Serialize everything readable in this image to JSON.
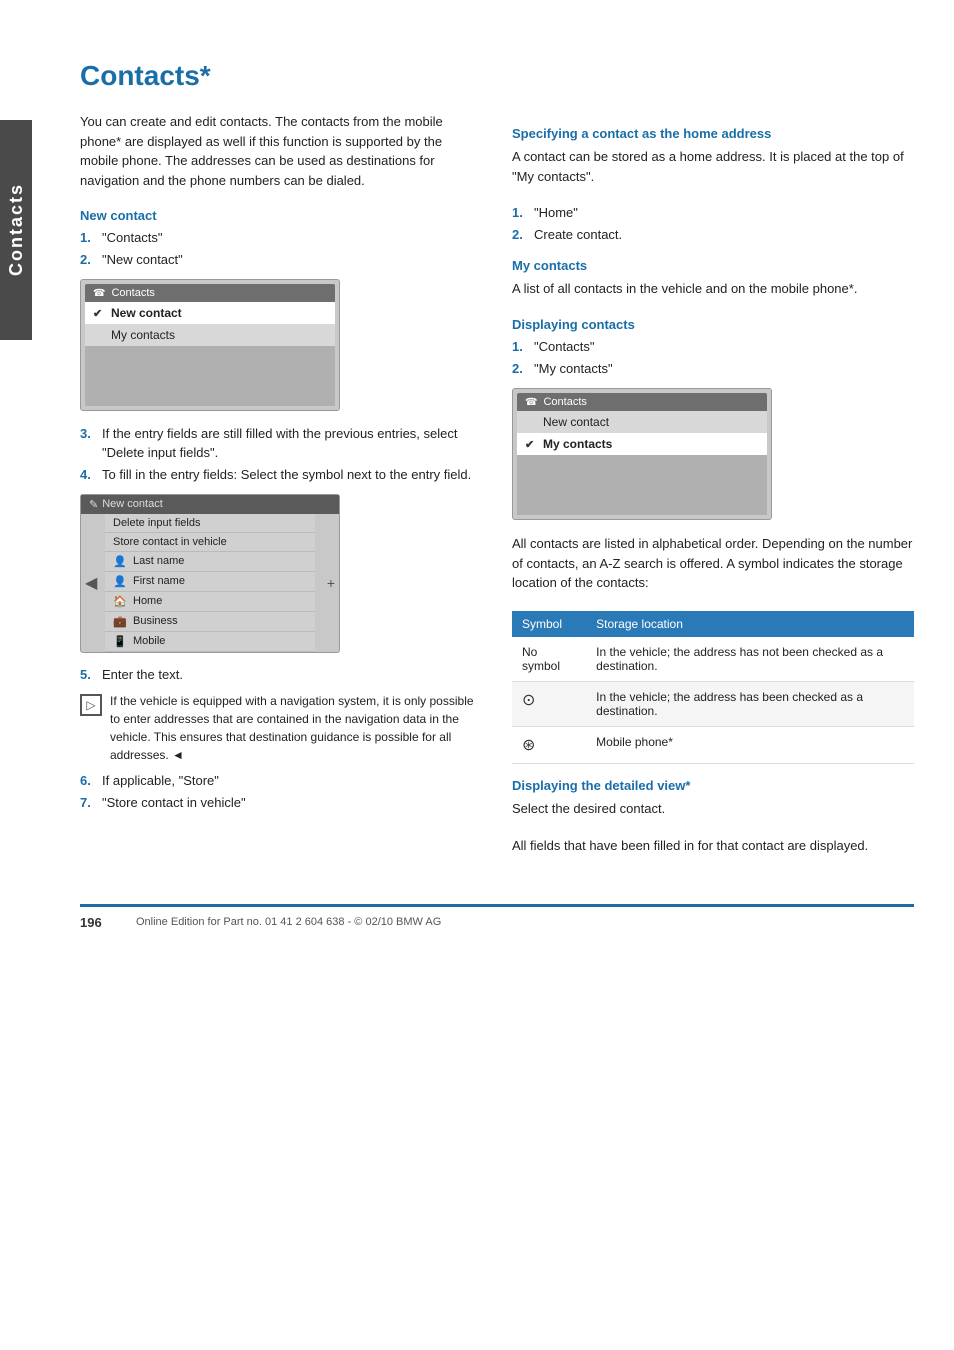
{
  "side_tab": {
    "label": "Contacts"
  },
  "page_title": "Contacts*",
  "intro": "You can create and edit contacts. The contacts from the mobile phone* are displayed as well if this function is supported by the mobile phone. The addresses can be used as destinations for navigation and the phone numbers can be dialed.",
  "left_column": {
    "new_contact": {
      "heading": "New contact",
      "steps": [
        {
          "num": "1.",
          "text": "\"Contacts\""
        },
        {
          "num": "2.",
          "text": "\"New contact\""
        }
      ],
      "ui1": {
        "title": "Contacts",
        "items": [
          {
            "label": "New contact",
            "selected": true
          },
          {
            "label": "My contacts",
            "selected": false
          }
        ]
      },
      "steps2": [
        {
          "num": "3.",
          "text": "If the entry fields are still filled with the previous entries, select \"Delete input fields\"."
        },
        {
          "num": "4.",
          "text": "To fill in the entry fields: Select the symbol next to the entry field."
        }
      ],
      "ui2": {
        "title": "New contact",
        "rows": [
          {
            "label": "Delete input fields",
            "icon": ""
          },
          {
            "label": "Store contact in vehicle",
            "icon": ""
          },
          {
            "label": "Last name",
            "icon": "person"
          },
          {
            "label": "First name",
            "icon": "person"
          },
          {
            "label": "Home",
            "icon": "home"
          },
          {
            "label": "Business",
            "icon": "business"
          },
          {
            "label": "Mobile",
            "icon": "mobile"
          }
        ]
      },
      "step5_label": "5.",
      "step5_text": "Enter the text.",
      "note_text": "If the vehicle is equipped with a navigation system, it is only possible to enter addresses that are contained in the navigation data in the vehicle. This ensures that destination guidance is possible for all addresses.",
      "note_end": "◄",
      "steps3": [
        {
          "num": "6.",
          "text": "If applicable, \"Store\""
        },
        {
          "num": "7.",
          "text": "\"Store contact in vehicle\""
        }
      ]
    }
  },
  "right_column": {
    "home_address": {
      "heading": "Specifying a contact as the home address",
      "text": "A contact can be stored as a home address. It is placed at the top of \"My contacts\".",
      "steps": [
        {
          "num": "1.",
          "text": "\"Home\""
        },
        {
          "num": "2.",
          "text": "Create contact."
        }
      ]
    },
    "my_contacts": {
      "heading": "My contacts",
      "text": "A list of all contacts in the vehicle and on the mobile phone*."
    },
    "displaying_contacts": {
      "heading": "Displaying contacts",
      "steps": [
        {
          "num": "1.",
          "text": "\"Contacts\""
        },
        {
          "num": "2.",
          "text": "\"My contacts\""
        }
      ],
      "ui": {
        "title": "Contacts",
        "items": [
          {
            "label": "New contact",
            "selected": false
          },
          {
            "label": "My contacts",
            "selected": true
          }
        ]
      },
      "text": "All contacts are listed in alphabetical order. Depending on the number of contacts, an A-Z search is offered. A symbol indicates the storage location of the contacts:"
    },
    "symbol_table": {
      "col1": "Symbol",
      "col2": "Storage location",
      "rows": [
        {
          "symbol": "No symbol",
          "description": "In the vehicle; the address has not been checked as a destination."
        },
        {
          "symbol": "⊙",
          "description": "In the vehicle; the address has been checked as a destination."
        },
        {
          "symbol": "⊛",
          "description": "Mobile phone*"
        }
      ]
    },
    "detailed_view": {
      "heading": "Displaying the detailed view*",
      "text1": "Select the desired contact.",
      "text2": "All fields that have been filled in for that contact are displayed."
    }
  },
  "footer": {
    "page_number": "196",
    "note": "Online Edition for Part no. 01 41 2 604 638 - © 02/10 BMW AG"
  }
}
